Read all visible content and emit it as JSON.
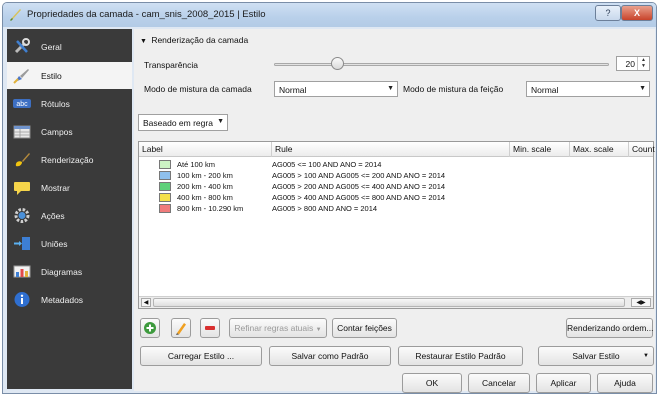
{
  "window": {
    "title": "Propriedades da camada - cam_snis_2008_2015 | Estilo",
    "help_label": "?",
    "close_label": "X"
  },
  "sidebar": {
    "items": [
      {
        "label": "Geral",
        "icon": "wrench-icon"
      },
      {
        "label": "Estilo",
        "icon": "paintbrush-icon"
      },
      {
        "label": "Rótulos",
        "icon": "abc-label-icon"
      },
      {
        "label": "Campos",
        "icon": "table-icon"
      },
      {
        "label": "Renderização",
        "icon": "brush-icon"
      },
      {
        "label": "Mostrar",
        "icon": "speech-bubble-icon"
      },
      {
        "label": "Ações",
        "icon": "gear-icon"
      },
      {
        "label": "Uniões",
        "icon": "join-icon"
      },
      {
        "label": "Diagramas",
        "icon": "chart-icon"
      },
      {
        "label": "Metadados",
        "icon": "info-icon"
      }
    ],
    "active_index": 1
  },
  "render": {
    "section_title": "Renderização da camada",
    "transparency_label": "Transparência",
    "transparency_value": "20",
    "layer_blend_label": "Modo de mistura da camada",
    "layer_blend_value": "Normal",
    "feature_blend_label": "Modo de mistura da feição",
    "feature_blend_value": "Normal"
  },
  "renderer": {
    "value": "Baseado em regra"
  },
  "rules_table": {
    "columns": [
      "Label",
      "Rule",
      "Min. scale",
      "Max. scale",
      "Count"
    ],
    "rows": [
      {
        "label": "Até 100 km",
        "rule": "AG005 <= 100 AND ANO = 2014",
        "color": "#ccf3c4"
      },
      {
        "label": "100 km - 200 km",
        "rule": "AG005 > 100 AND AG005 <= 200 AND ANO = 2014",
        "color": "#8fc0ec"
      },
      {
        "label": "200 km - 400 km",
        "rule": "AG005 > 200 AND AG005 <= 400 AND ANO = 2014",
        "color": "#5ed17a"
      },
      {
        "label": "400 km - 800 km",
        "rule": "AG005 > 400 AND AG005 <= 800 AND ANO = 2014",
        "color": "#f4e14a"
      },
      {
        "label": "800 km - 10.290 km",
        "rule": "AG005 > 800 AND ANO = 2014",
        "color": "#f07c7c"
      }
    ]
  },
  "toolbar": {
    "add_icon": "add-rule-icon",
    "edit_icon": "edit-rule-icon",
    "remove_icon": "remove-rule-icon",
    "refine_label": "Refinar regras atuais",
    "count_label": "Contar feições",
    "render_order_label": "Renderizando ordem..."
  },
  "style_buttons": {
    "load": "Carregar Estilo ...",
    "save_default": "Salvar como Padrão",
    "restore_default": "Restaurar Estilo Padrão",
    "save": "Salvar Estilo"
  },
  "dialog": {
    "ok": "OK",
    "cancel": "Cancelar",
    "apply": "Aplicar",
    "help": "Ajuda"
  }
}
